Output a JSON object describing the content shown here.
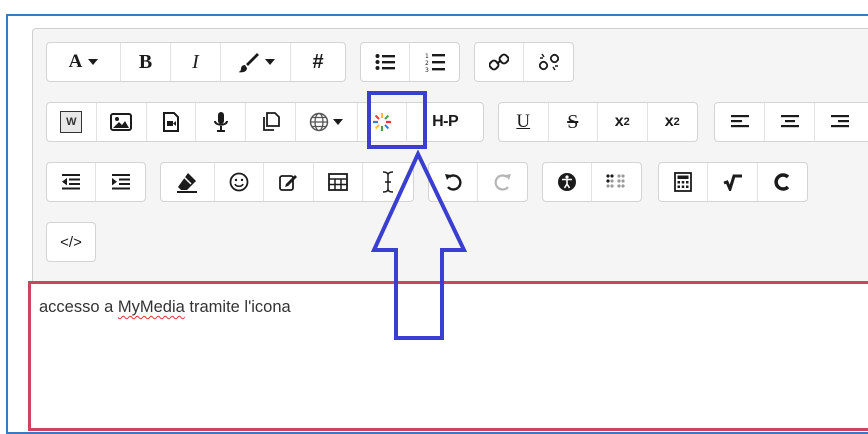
{
  "toolbar": {
    "row1": {
      "font_color": "A",
      "bold": "B",
      "italic": "I",
      "hash": "#"
    },
    "row2": {
      "word_icon": "W",
      "h5p": "H-P",
      "underline": "U",
      "strike": "S",
      "sub_base": "x",
      "sub_index": "2",
      "sup_base": "x",
      "sup_index": "2"
    },
    "row4": {
      "html": "</>"
    }
  },
  "content": {
    "text_before": "accesso a ",
    "text_misspelled": "MyMedia",
    "text_after": " tramite l'icona"
  },
  "colors": {
    "frame_border": "#3b78c2",
    "content_border": "#c9465e",
    "highlight": "#3b3fd0",
    "mymedia_icon_colors": [
      "#e53935",
      "#fbc02d",
      "#43a047",
      "#1e88e5"
    ]
  }
}
